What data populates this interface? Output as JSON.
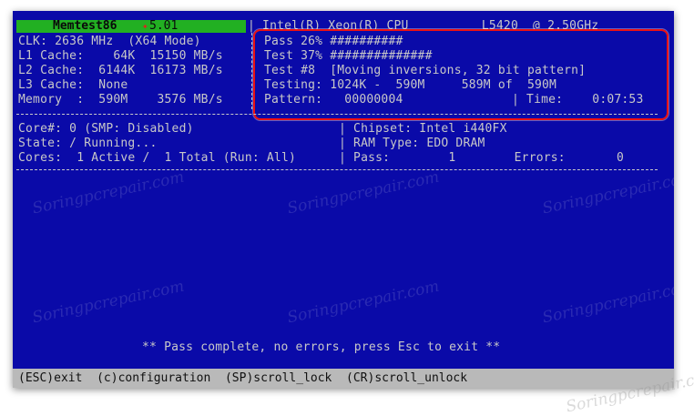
{
  "header": {
    "app_name": "Memtest86",
    "version": "5.01",
    "cpu_text": "| Intel(R) Xeon(R) CPU          L5420  @ 2.50GHz"
  },
  "system": {
    "clk": "CLK: 2636 MHz  (X64 Mode)",
    "l1": "L1 Cache:    64K  15150 MB/s",
    "l2": "L2 Cache:  6144K  16173 MB/s",
    "l3": "L3 Cache:  None",
    "memory": "Memory  :  590M    3576 MB/s"
  },
  "progress": {
    "pass": "Pass 26% ##########",
    "test": "Test 37% ##############",
    "test_num": "Test #8  [Moving inversions, 32 bit pattern]",
    "testing": "Testing: 1024K -  590M     589M of  590M",
    "pattern": "Pattern:   00000004",
    "time": "| Time:    0:07:53"
  },
  "core": {
    "core_line": "Core#: 0 (SMP: Disabled)",
    "state_line": "State: / Running...",
    "cores_line": "Cores:  1 Active /  1 Total (Run: All)",
    "chipset": "| Chipset: Intel i440FX",
    "ram_type": "| RAM Type: EDO DRAM",
    "pass_errors": "| Pass:        1        Errors:       0"
  },
  "status_message": "** Pass complete, no errors, press Esc to exit **",
  "footer": {
    "text": "(ESC)exit  (c)configuration  (SP)scroll_lock  (CR)scroll_unlock"
  },
  "watermark": "Soringpcrepair.com",
  "colors": {
    "background": "#0a0aa8",
    "title_bar": "#22b022",
    "highlight": "#ee1111",
    "footer": "#b9b9b9"
  }
}
